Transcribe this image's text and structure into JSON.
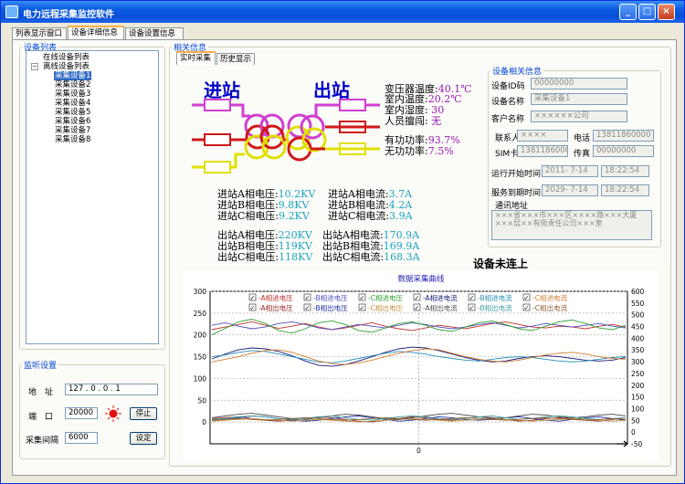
{
  "window": {
    "title": "电力远程采集监控软件"
  },
  "main_tabs": [
    "列表显示窗口",
    "设备详细信息",
    "设备设置信息"
  ],
  "device_list": {
    "legend": "设备列表",
    "online": "在线设备列表",
    "offline": "离线设备列表",
    "devices": [
      "采集设备1",
      "采集设备2",
      "采集设备3",
      "采集设备4",
      "采集设备5",
      "采集设备6",
      "采集设备7",
      "采集设备8"
    ]
  },
  "monitor": {
    "legend": "监听设置",
    "address_label": "地　址",
    "address_value": "127 .  0 .  0 .  1",
    "port_label": "端　口",
    "port_value": "20000",
    "stop_button": "停止",
    "interval_label": "采集间隔",
    "interval_value": "6000",
    "set_button": "设定"
  },
  "info": {
    "legend": "相关信息",
    "subtabs": [
      "实时采集",
      "历史显示"
    ],
    "in_title": "进站",
    "out_title": "出站",
    "env": [
      {
        "label": "变压器温度:",
        "value": "40.1℃"
      },
      {
        "label": "室内温度:",
        "value": "20.2℃"
      },
      {
        "label": "室内湿度:",
        "value": "30"
      },
      {
        "label": "人员擅闯:",
        "value": "无"
      }
    ],
    "power": [
      {
        "label": "有功功率:",
        "value": "93.7%"
      },
      {
        "label": "无功功率:",
        "value": "7.5%"
      }
    ],
    "in_volt": [
      {
        "label": "进站A相电压:",
        "value": "10.2KV"
      },
      {
        "label": "进站B相电压:",
        "value": "9.8KV"
      },
      {
        "label": "进站C相电压:",
        "value": "9.2KV"
      }
    ],
    "in_curr": [
      {
        "label": "进站A相电流:",
        "value": "3.7A"
      },
      {
        "label": "进站B相电流:",
        "value": "4.2A"
      },
      {
        "label": "进站C相电流:",
        "value": "3.9A"
      }
    ],
    "out_volt": [
      {
        "label": "出站A相电压:",
        "value": "220KV"
      },
      {
        "label": "出站B相电压:",
        "value": "119KV"
      },
      {
        "label": "出站C相电压:",
        "value": "118KV"
      }
    ],
    "out_curr": [
      {
        "label": "出站A相电流:",
        "value": "170.9A"
      },
      {
        "label": "出站B相电流:",
        "value": "169.9A"
      },
      {
        "label": "出站C相电流:",
        "value": "168.3A"
      }
    ],
    "status": "设备未连上"
  },
  "device_info": {
    "legend": "设备相关信息",
    "id_label": "设备ID码",
    "id_value": "00000000",
    "name_label": "设备名称",
    "name_value": "采集设备1",
    "customer_label": "客户名称",
    "customer_value": "××××××公司",
    "contact_label": "联系人",
    "contact_value": "××××",
    "phone_label": "电话",
    "phone_value": "13811860000",
    "sim_label": "SIM卡",
    "sim_value": "13811860000",
    "fax_label": "传真",
    "fax_value": "00000000",
    "start_label": "运行开始时间",
    "start_date": "2011- 7-14",
    "start_time": "18:22:54",
    "end_label": "服务到期时间",
    "end_date": "2029- 7-14",
    "end_time": "18:22:54",
    "addr_label": "通讯地址",
    "addr_value": "×××省×××市×××区××××路×××大厦×××层××有限责任公司×××室"
  },
  "chart_data": {
    "type": "line",
    "title": "数据采集曲线",
    "x_tick": "0",
    "y_left": {
      "ylim": [
        -50,
        300
      ],
      "ticks": [
        0,
        50,
        100,
        150,
        200,
        250,
        300
      ]
    },
    "y_right": {
      "ylim": [
        -50,
        600
      ],
      "ticks": [
        -50,
        0,
        50,
        100,
        150,
        200,
        250,
        300,
        350,
        400,
        450,
        500,
        550,
        600
      ]
    },
    "grid": true,
    "legend_position": "top",
    "series": [
      {
        "name": "A相进电压",
        "color": "#c03030",
        "values": [
          212,
          218,
          224,
          230,
          222,
          215,
          220,
          226,
          218,
          212,
          216,
          222,
          228,
          220,
          214,
          210,
          216,
          222,
          218,
          214,
          220,
          226,
          230,
          224,
          218,
          216,
          220,
          218,
          214,
          220,
          224,
          218
        ]
      },
      {
        "name": "B相进电压",
        "color": "#5050c0",
        "values": [
          222,
          228,
          220,
          214,
          218,
          226,
          230,
          224,
          216,
          212,
          218,
          224,
          220,
          216,
          222,
          228,
          224,
          218,
          214,
          218,
          224,
          228,
          222,
          216,
          220,
          226,
          222,
          218,
          222,
          226,
          220,
          216
        ]
      },
      {
        "name": "C相进电压",
        "color": "#30a030",
        "values": [
          200,
          215,
          230,
          236,
          226,
          210,
          204,
          214,
          228,
          232,
          224,
          210,
          206,
          216,
          226,
          230,
          222,
          212,
          208,
          218,
          228,
          232,
          224,
          214,
          210,
          220,
          230,
          234,
          226,
          216,
          212,
          222
        ]
      },
      {
        "name": "A相进电流",
        "color": "#1a1a7a",
        "values": [
          145,
          156,
          166,
          170,
          168,
          162,
          152,
          140,
          130,
          128,
          132,
          140,
          150,
          160,
          168,
          172,
          170,
          164,
          156,
          148,
          142,
          138,
          140,
          146,
          150,
          152,
          150,
          146,
          142,
          140,
          142,
          148
        ]
      },
      {
        "name": "B相进电流",
        "color": "#2a8fb5",
        "values": [
          150,
          154,
          160,
          164,
          162,
          156,
          150,
          144,
          138,
          136,
          140,
          146,
          152,
          158,
          162,
          160,
          156,
          150,
          146,
          142,
          140,
          144,
          148,
          150,
          148,
          144,
          140,
          138,
          140,
          144,
          148,
          150
        ]
      },
      {
        "name": "C相进电流",
        "color": "#d08030",
        "values": [
          138,
          144,
          150,
          158,
          164,
          166,
          160,
          150,
          140,
          134,
          132,
          136,
          142,
          150,
          158,
          164,
          168,
          166,
          158,
          150,
          144,
          140,
          138,
          142,
          148,
          154,
          158,
          160,
          156,
          150,
          146,
          144
        ]
      },
      {
        "name": "A相出电压",
        "color": "#a02828",
        "values": [
          8,
          10,
          12,
          8,
          4,
          2,
          4,
          8,
          12,
          10,
          6,
          2,
          0,
          4,
          8,
          12,
          10,
          6,
          4,
          8,
          12,
          10,
          6,
          2,
          4,
          8,
          10,
          8,
          4,
          2,
          6,
          10
        ]
      },
      {
        "name": "B相出电压",
        "color": "#2030a0",
        "values": [
          4,
          6,
          10,
          14,
          12,
          8,
          4,
          2,
          4,
          8,
          12,
          14,
          10,
          6,
          2,
          4,
          8,
          12,
          10,
          6,
          4,
          6,
          10,
          12,
          8,
          4,
          2,
          6,
          10,
          12,
          8,
          4
        ]
      },
      {
        "name": "C相出电压",
        "color": "#c09040",
        "values": [
          2,
          4,
          6,
          8,
          6,
          4,
          2,
          4,
          6,
          4,
          2,
          0,
          2,
          4,
          6,
          8,
          6,
          4,
          2,
          4,
          6,
          8,
          6,
          4,
          2,
          4,
          6,
          8,
          6,
          4,
          2,
          4
        ]
      },
      {
        "name": "A相出电流",
        "color": "#505050",
        "values": [
          10,
          14,
          18,
          20,
          16,
          12,
          8,
          6,
          10,
          14,
          18,
          16,
          12,
          8,
          6,
          10,
          14,
          18,
          20,
          16,
          12,
          8,
          10,
          14,
          18,
          16,
          12,
          10,
          12,
          16,
          18,
          14
        ]
      },
      {
        "name": "B相出电流",
        "color": "#40a0a0",
        "values": [
          6,
          8,
          12,
          14,
          12,
          8,
          6,
          8,
          12,
          14,
          10,
          6,
          4,
          8,
          12,
          14,
          12,
          8,
          6,
          8,
          12,
          14,
          10,
          6,
          8,
          12,
          14,
          12,
          8,
          6,
          8,
          10
        ]
      },
      {
        "name": "C相出电流",
        "color": "#8a6030",
        "values": [
          4,
          6,
          8,
          6,
          4,
          6,
          8,
          10,
          8,
          6,
          4,
          6,
          8,
          10,
          8,
          6,
          4,
          6,
          8,
          10,
          8,
          6,
          4,
          6,
          8,
          10,
          8,
          6,
          4,
          6,
          8,
          6
        ]
      }
    ]
  }
}
